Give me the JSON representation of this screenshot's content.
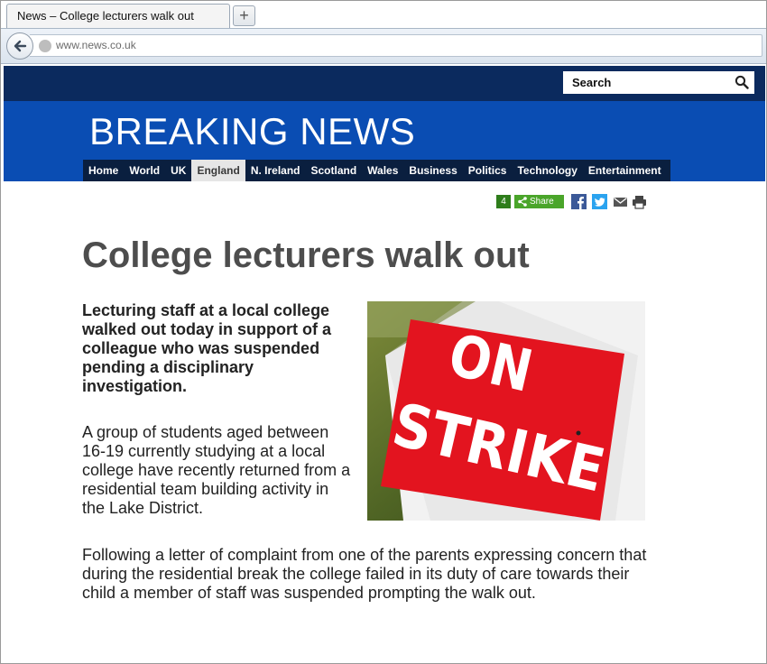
{
  "browser": {
    "tab_title": "News – College lecturers walk out",
    "new_tab_label": "+",
    "url": "www.news.co.uk"
  },
  "header": {
    "search_label": "Search",
    "banner_title": "BREAKING NEWS"
  },
  "nav": {
    "items": [
      "Home",
      "World",
      "UK",
      "England",
      "N. Ireland",
      "Scotland",
      "Wales",
      "Business",
      "Politics",
      "Technology",
      "Entertainment"
    ],
    "active": "England"
  },
  "share": {
    "count": "4",
    "label": "Share",
    "icons": [
      "facebook-icon",
      "twitter-icon",
      "email-icon",
      "print-icon"
    ]
  },
  "article": {
    "headline": "College lecturers walk out",
    "lead": "Lecturing staff at a local college walked out today in support of a colleague who was suspended pending a disciplinary investigation.",
    "paragraph1": "A group of students aged between 16-19 currently studying at a local college have recently returned from a residential team building activity in the Lake District.",
    "paragraph2": "Following a letter of complaint  from one of the parents expressing concern that during the residential break the college failed in its duty of care towards their child a member of staff was suspended prompting the walk out.",
    "image_text_line1": "ON",
    "image_text_line2": "STRIKE"
  },
  "colors": {
    "top_strip": "#0b2a5e",
    "banner": "#0a4db3",
    "nav_bg": "#0a1f3f",
    "share_green": "#4aa52a",
    "sign_red": "#e3141f"
  }
}
